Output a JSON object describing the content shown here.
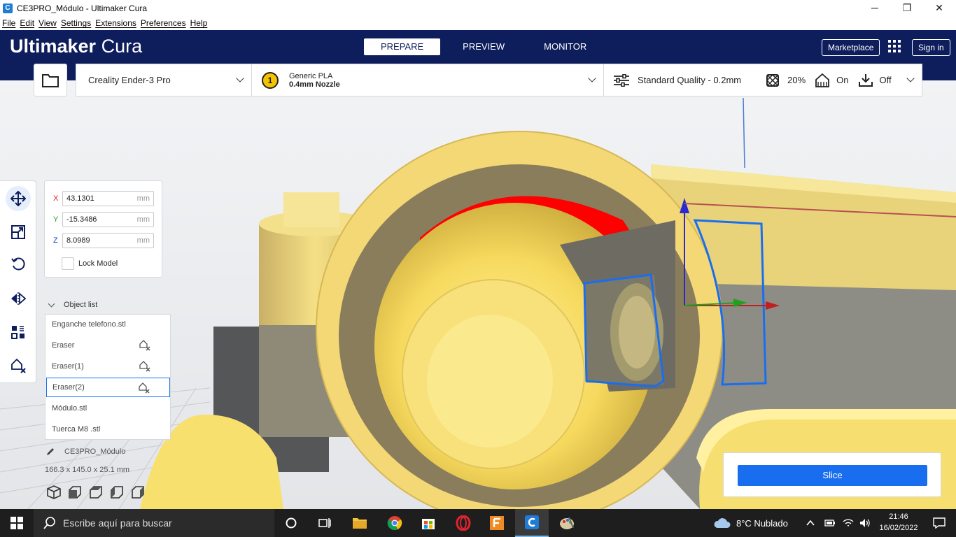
{
  "window": {
    "title": "CE3PRO_Módulo - Ultimaker Cura",
    "minimize": "─",
    "restore": "❐",
    "close": "✕"
  },
  "menu": [
    "File",
    "Edit",
    "View",
    "Settings",
    "Extensions",
    "Preferences",
    "Help"
  ],
  "header": {
    "brand_bold": "Ultimaker",
    "brand_light": "Cura",
    "tabs": [
      "PREPARE",
      "PREVIEW",
      "MONITOR"
    ],
    "active_tab": "PREPARE",
    "marketplace": "Marketplace",
    "sign_in": "Sign in"
  },
  "config": {
    "printer": "Creality Ender-3 Pro",
    "extruder_number": "1",
    "material": "Generic PLA",
    "nozzle": "0.4mm Nozzle",
    "quality": "Standard Quality - 0.2mm",
    "infill": "20%",
    "support": "On",
    "adhesion": "Off"
  },
  "move_panel": {
    "x_label": "X",
    "x_value": "43.1301",
    "y_label": "Y",
    "y_value": "-15.3486",
    "z_label": "Z",
    "z_value": "8.0989",
    "unit": "mm",
    "lock_model": "Lock Model",
    "axis_colors": {
      "x": "#e02020",
      "y": "#2ca02c",
      "z": "#1f3fc8"
    }
  },
  "object_list": {
    "title": "Object list",
    "items": [
      {
        "name": "Enganche telefono.stl",
        "eraser": false,
        "selected": false
      },
      {
        "name": "Eraser",
        "eraser": true,
        "selected": false
      },
      {
        "name": "Eraser(1)",
        "eraser": true,
        "selected": false
      },
      {
        "name": "Eraser(2)",
        "eraser": true,
        "selected": true
      },
      {
        "name": "Módulo.stl",
        "eraser": false,
        "selected": false
      },
      {
        "name": "Tuerca M8 .stl",
        "eraser": false,
        "selected": false
      }
    ]
  },
  "project": {
    "name": "CE3PRO_Módulo",
    "dimensions": "166.3 x 145.0 x 25.1 mm"
  },
  "slice": {
    "label": "Slice"
  },
  "taskbar": {
    "search_placeholder": "Escribe aquí para buscar",
    "weather": "8°C  Nublado",
    "time": "21:46",
    "date": "16/02/2022"
  },
  "colors": {
    "header_bg": "#0e1d5b",
    "accent": "#196ef0",
    "model_yellow": "#fbe27a",
    "overhang_red": "#ff0000"
  }
}
